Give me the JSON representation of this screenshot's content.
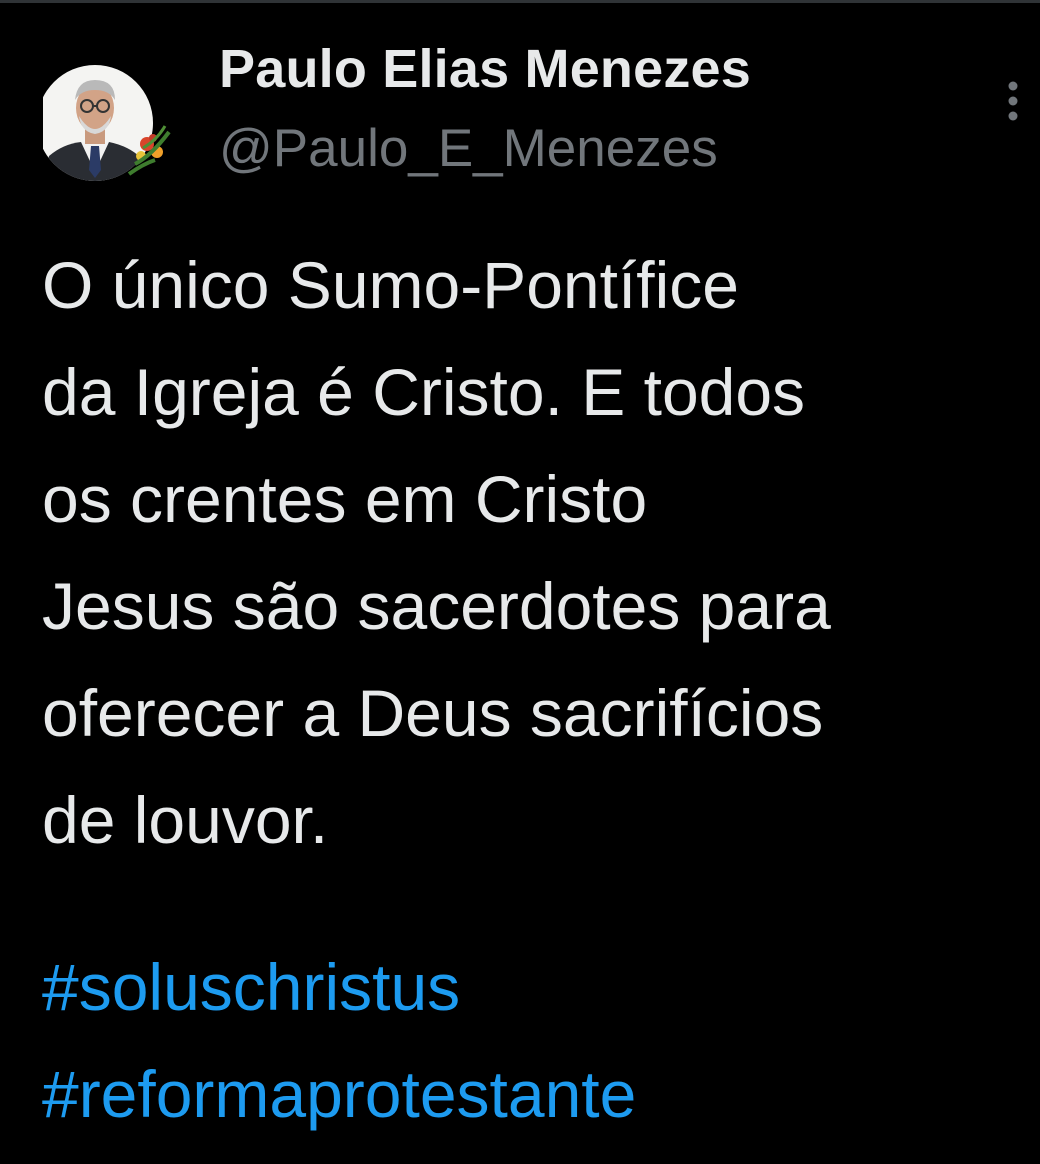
{
  "author": {
    "name": "Paulo Elias Menezes",
    "handle": "@Paulo_E_Menezes",
    "avatar_icon": "profile-photo"
  },
  "more_icon": "vertical-ellipsis-icon",
  "tweet": {
    "lines": [
      "O único Sumo-Pontífice",
      "da Igreja é Cristo. E todos",
      "os crentes em Cristo",
      "Jesus são sacerdotes para",
      "oferecer a Deus sacrifícios",
      "de louvor."
    ],
    "hashtags": [
      "#soluschristus",
      "#reformaprotestante"
    ]
  },
  "colors": {
    "background": "#000000",
    "text": "#e7e9ea",
    "secondary_text": "#71767b",
    "link": "#1d9bf0"
  }
}
